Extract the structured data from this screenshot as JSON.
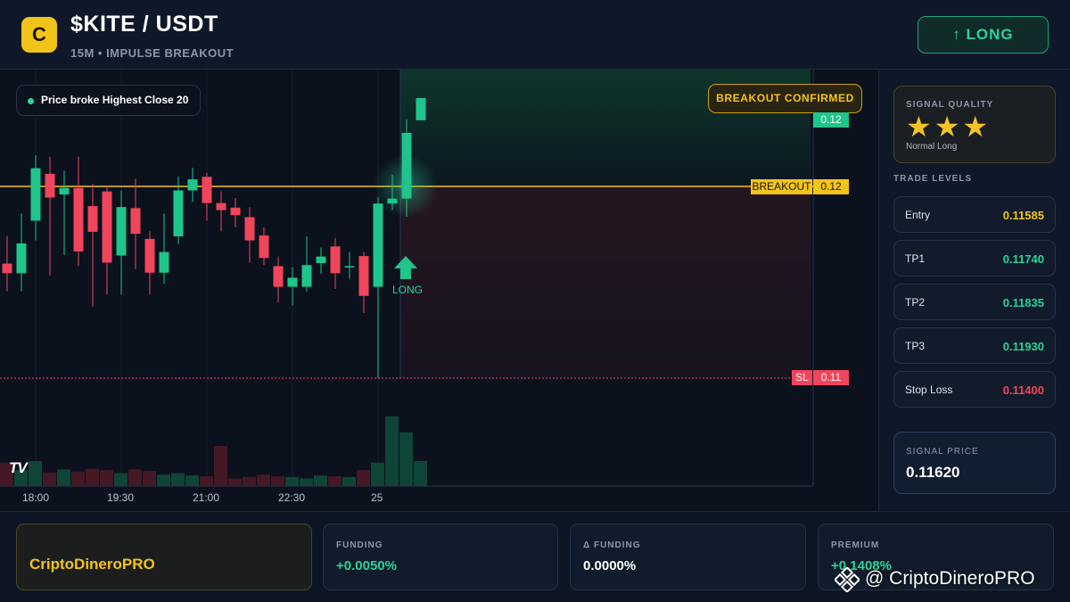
{
  "header": {
    "logo_letter": "C",
    "pair": "$KITE / USDT",
    "subtitle": "15M • IMPULSE BREAKOUT",
    "direction_button": "↑ LONG"
  },
  "chart": {
    "note": "Price broke Highest Close 20",
    "confirm_badge": "BREAKOUT CONFIRMED",
    "top_price_tag": "0.12",
    "breakout_label": "BREAKOUT",
    "breakout_value": "0.12",
    "sl_label": "SL",
    "sl_value": "0.11",
    "signal_arrow_label": "LONG",
    "tv_logo": "TV",
    "x_labels": [
      "18:00",
      "19:30",
      "21:00",
      "22:30",
      "25"
    ],
    "colors": {
      "up": "#1fc58a",
      "down": "#f0455b",
      "breakout": "#f3c419",
      "sl": "#f0455b"
    }
  },
  "chart_data": {
    "type": "candlestick",
    "title": "",
    "x_labels": [
      "18:00",
      "19:30",
      "21:00",
      "22:30",
      "25"
    ],
    "breakout_level": 0.12,
    "stop_loss_level": 0.11,
    "top_price_tag": 0.12,
    "candles": [
      {
        "d": "down",
        "o": 0.11627,
        "c": 0.11608,
        "h": 0.11682,
        "l": 0.11572
      },
      {
        "d": "up",
        "o": 0.11608,
        "c": 0.11667,
        "h": 0.11726,
        "l": 0.11572
      },
      {
        "d": "up",
        "o": 0.11712,
        "c": 0.11816,
        "h": 0.11842,
        "l": 0.11673
      },
      {
        "d": "down",
        "o": 0.11805,
        "c": 0.11758,
        "h": 0.11839,
        "l": 0.11603
      },
      {
        "d": "up",
        "o": 0.11764,
        "c": 0.11777,
        "h": 0.11811,
        "l": 0.11644
      },
      {
        "d": "down",
        "o": 0.11777,
        "c": 0.11651,
        "h": 0.11839,
        "l": 0.11622
      },
      {
        "d": "down",
        "o": 0.11741,
        "c": 0.1169,
        "h": 0.11785,
        "l": 0.11542
      },
      {
        "d": "down",
        "o": 0.1177,
        "c": 0.11629,
        "h": 0.11781,
        "l": 0.11566
      },
      {
        "d": "up",
        "o": 0.11643,
        "c": 0.11739,
        "h": 0.11772,
        "l": 0.11566
      },
      {
        "d": "down",
        "o": 0.11737,
        "c": 0.11686,
        "h": 0.11795,
        "l": 0.11616
      },
      {
        "d": "down",
        "o": 0.11676,
        "c": 0.11609,
        "h": 0.11691,
        "l": 0.11566
      },
      {
        "d": "up",
        "o": 0.11609,
        "c": 0.1165,
        "h": 0.11726,
        "l": 0.11587
      },
      {
        "d": "up",
        "o": 0.11681,
        "c": 0.11772,
        "h": 0.118,
        "l": 0.11666
      },
      {
        "d": "up",
        "o": 0.11772,
        "c": 0.11794,
        "h": 0.11817,
        "l": 0.11749
      },
      {
        "d": "down",
        "o": 0.11799,
        "c": 0.11747,
        "h": 0.11807,
        "l": 0.11712
      },
      {
        "d": "down",
        "o": 0.11747,
        "c": 0.11733,
        "h": 0.1177,
        "l": 0.11691
      },
      {
        "d": "down",
        "o": 0.11738,
        "c": 0.11723,
        "h": 0.11757,
        "l": 0.11699
      },
      {
        "d": "down",
        "o": 0.11719,
        "c": 0.11673,
        "h": 0.11739,
        "l": 0.11629
      },
      {
        "d": "down",
        "o": 0.11683,
        "c": 0.11638,
        "h": 0.11699,
        "l": 0.11624
      },
      {
        "d": "down",
        "o": 0.11622,
        "c": 0.11581,
        "h": 0.1164,
        "l": 0.1155
      },
      {
        "d": "up",
        "o": 0.11581,
        "c": 0.11599,
        "h": 0.1162,
        "l": 0.11544
      },
      {
        "d": "up",
        "o": 0.11581,
        "c": 0.11624,
        "h": 0.11681,
        "l": 0.11572
      },
      {
        "d": "up",
        "o": 0.11628,
        "c": 0.11641,
        "h": 0.11659,
        "l": 0.11607
      },
      {
        "d": "down",
        "o": 0.11661,
        "c": 0.11608,
        "h": 0.11678,
        "l": 0.11577
      },
      {
        "d": "up",
        "o": 0.1162,
        "c": 0.11622,
        "h": 0.1165,
        "l": 0.11597
      },
      {
        "d": "down",
        "o": 0.11642,
        "c": 0.11563,
        "h": 0.1165,
        "l": 0.11529
      },
      {
        "d": "up",
        "o": 0.11581,
        "c": 0.11746,
        "h": 0.11759,
        "l": 0.114
      },
      {
        "d": "up",
        "o": 0.11746,
        "c": 0.11756,
        "h": 0.11803,
        "l": 0.11733
      },
      {
        "d": "up",
        "o": 0.11756,
        "c": 0.11886,
        "h": 0.11913,
        "l": 0.1172
      },
      {
        "d": "up",
        "o": 0.11911,
        "c": 0.11955,
        "h": 0.11955,
        "l": 0.11911
      }
    ],
    "volume": [
      0.31,
      0.21,
      0.33,
      0.18,
      0.22,
      0.19,
      0.23,
      0.21,
      0.17,
      0.22,
      0.2,
      0.15,
      0.17,
      0.14,
      0.13,
      0.53,
      0.1,
      0.12,
      0.15,
      0.13,
      0.12,
      0.1,
      0.14,
      0.13,
      0.12,
      0.21,
      0.31,
      0.92,
      0.71,
      0.33
    ]
  },
  "signal_quality": {
    "title": "SIGNAL QUALITY",
    "stars": 3,
    "max_stars": 3,
    "star_glyphs": "★★★",
    "subtitle": "Normal Long"
  },
  "trade_levels": {
    "title": "TRADE LEVELS",
    "rows": [
      {
        "label": "Entry",
        "value": "0.11585",
        "color": "#f3c419"
      },
      {
        "label": "TP1",
        "value": "0.11740",
        "color": "#2bd497"
      },
      {
        "label": "TP2",
        "value": "0.11835",
        "color": "#2bd497"
      },
      {
        "label": "TP3",
        "value": "0.11930",
        "color": "#2bd497"
      },
      {
        "label": "Stop Loss",
        "value": "0.11400",
        "color": "#f0455b"
      }
    ]
  },
  "signal_price": {
    "label": "SIGNAL PRICE",
    "value": "0.11620"
  },
  "footer": {
    "brand": "CriptoDineroPRO",
    "funding_label": "FUNDING",
    "funding_value": "+0.0050%",
    "delta_label": "Δ FUNDING",
    "delta_value": "0.0000%",
    "premium_label": "PREMIUM",
    "premium_value": "+0.1408%",
    "watermark": "@ CriptoDineroPRO"
  }
}
